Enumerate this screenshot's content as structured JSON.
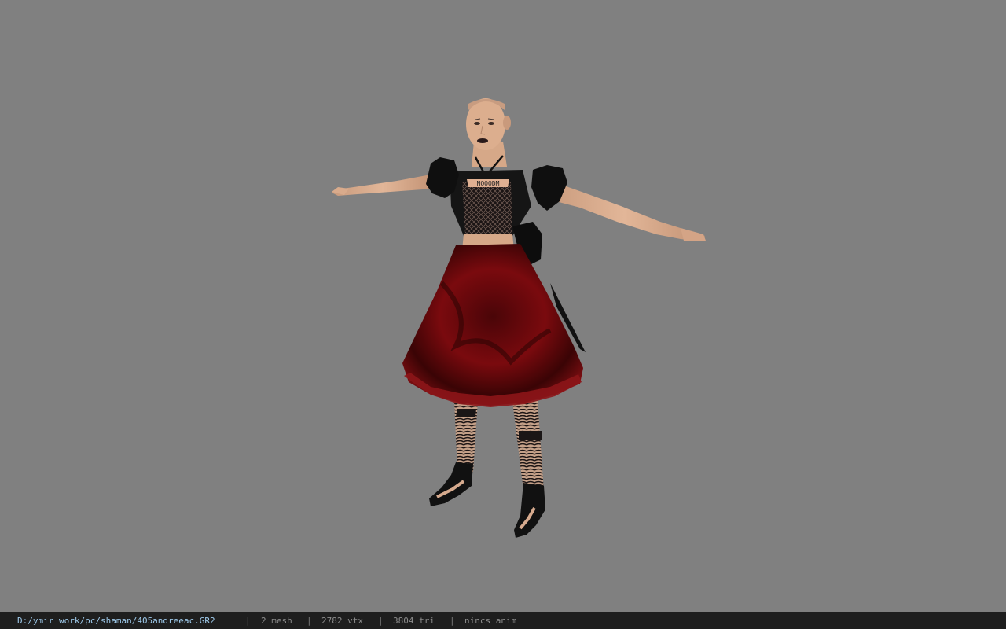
{
  "viewport": {
    "background_color": "#808080",
    "model": {
      "chest_inscription": "NOOODM",
      "skirt_color": "#7a0a0e",
      "top_color": "#141414",
      "skin_color": "#d8aa8a"
    }
  },
  "statusbar": {
    "file_path": "D:/ymir work/pc/shaman/405andreeac.GR2",
    "separator": "|",
    "mesh_count": "2 mesh",
    "vertex_count": "2782 vtx",
    "triangle_count": "3804 tri",
    "animation": "nincs anim",
    "path_color": "#9ec9ea",
    "background_color": "#1e1e1e"
  }
}
